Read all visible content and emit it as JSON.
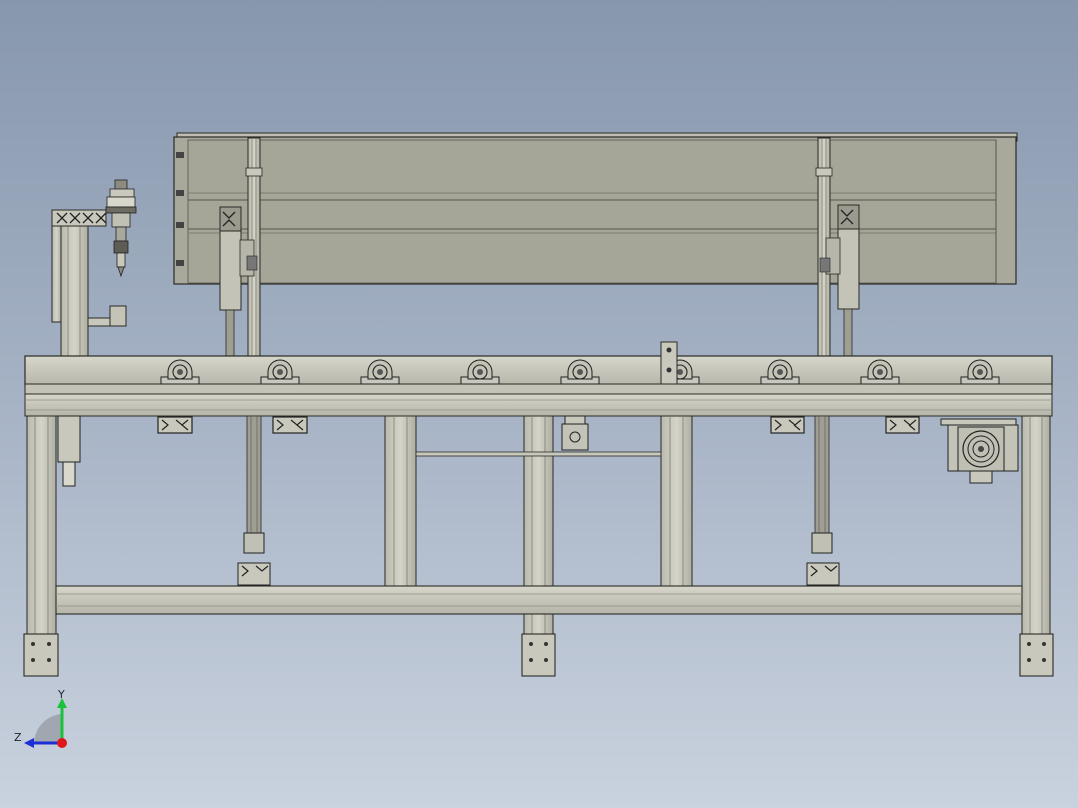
{
  "view": {
    "background_top": "#8797ad",
    "background_bottom": "#c9d2de",
    "body_color": "#c8c8bd",
    "hopper_color": "#a8a89b",
    "line_color": "#2a2a26"
  },
  "triad": {
    "y_label": "Y",
    "z_label": "Z",
    "y_color": "#19c23a",
    "z_color": "#1c2fd6",
    "x_color": "#e0161b"
  },
  "model": {
    "roller_count": 9,
    "cylinder_count": 2,
    "leg_count": 3
  }
}
